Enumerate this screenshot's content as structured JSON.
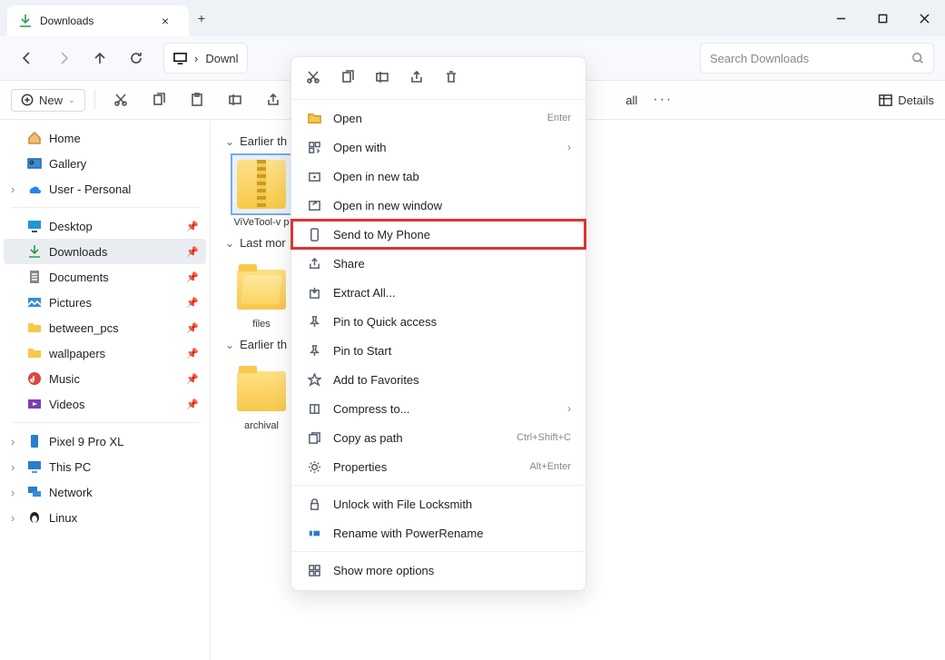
{
  "tab": {
    "title": "Downloads"
  },
  "address": {
    "label": "Downl"
  },
  "search": {
    "placeholder": "Search Downloads"
  },
  "toolbar": {
    "new_label": "New",
    "select_all": "all",
    "details": "Details"
  },
  "sidebar": {
    "top": [
      {
        "label": "Home"
      },
      {
        "label": "Gallery"
      },
      {
        "label": "User - Personal"
      }
    ],
    "pinned": [
      {
        "label": "Desktop"
      },
      {
        "label": "Downloads"
      },
      {
        "label": "Documents"
      },
      {
        "label": "Pictures"
      },
      {
        "label": "between_pcs"
      },
      {
        "label": "wallpapers"
      },
      {
        "label": "Music"
      },
      {
        "label": "Videos"
      }
    ],
    "bottom": [
      {
        "label": "Pixel 9 Pro XL"
      },
      {
        "label": "This PC"
      },
      {
        "label": "Network"
      },
      {
        "label": "Linux"
      }
    ]
  },
  "groups": [
    {
      "header": "Earlier th",
      "files": [
        {
          "name": "ViVeTool-v p"
        }
      ]
    },
    {
      "header": "Last mor",
      "files": [
        {
          "name": "files"
        }
      ]
    },
    {
      "header": "Earlier th",
      "files": [
        {
          "name": "archival"
        }
      ]
    }
  ],
  "context_menu": {
    "items": [
      {
        "label": "Open",
        "shortcut": "Enter"
      },
      {
        "label": "Open with",
        "submenu": true
      },
      {
        "label": "Open in new tab"
      },
      {
        "label": "Open in new window"
      },
      {
        "label": "Send to My Phone"
      },
      {
        "label": "Share"
      },
      {
        "label": "Extract All..."
      },
      {
        "label": "Pin to Quick access"
      },
      {
        "label": "Pin to Start"
      },
      {
        "label": "Add to Favorites"
      },
      {
        "label": "Compress to...",
        "submenu": true
      },
      {
        "label": "Copy as path",
        "shortcut": "Ctrl+Shift+C"
      },
      {
        "label": "Properties",
        "shortcut": "Alt+Enter"
      },
      {
        "label": "Unlock with File Locksmith"
      },
      {
        "label": "Rename with PowerRename"
      },
      {
        "label": "Show more options"
      }
    ]
  }
}
